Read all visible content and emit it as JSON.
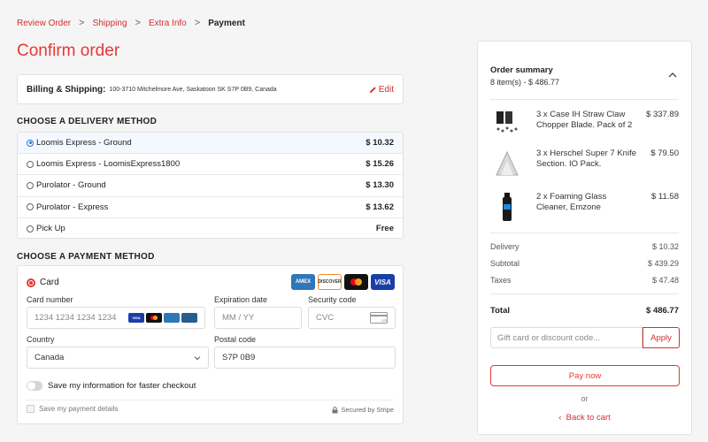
{
  "breadcrumb": {
    "items": [
      "Review Order",
      "Shipping",
      "Extra Info"
    ],
    "current": "Payment",
    "separator": ">"
  },
  "page_title": "Confirm order",
  "billing": {
    "label": "Billing & Shipping:",
    "address": "100-3710 Mitchelmore Ave, Saskatoon SK S7P 0B9, Canada",
    "edit_label": "Edit"
  },
  "delivery": {
    "heading": "CHOOSE A DELIVERY METHOD",
    "options": [
      {
        "label": "Loomis Express - Ground",
        "price": "$ 10.32",
        "selected": true
      },
      {
        "label": "Loomis Express - LoomisExpress1800",
        "price": "$ 15.26",
        "selected": false
      },
      {
        "label": "Purolator - Ground",
        "price": "$ 13.30",
        "selected": false
      },
      {
        "label": "Purolator - Express",
        "price": "$ 13.62",
        "selected": false
      },
      {
        "label": "Pick Up",
        "price": "Free",
        "selected": false
      }
    ]
  },
  "payment": {
    "heading": "CHOOSE A PAYMENT METHOD",
    "method_label": "Card",
    "brands": [
      "AMEX",
      "DISCOVER",
      "mastercard",
      "VISA"
    ],
    "card_number_label": "Card number",
    "card_number_placeholder": "1234 1234 1234 1234",
    "expiration_label": "Expiration date",
    "expiration_placeholder": "MM / YY",
    "security_label": "Security code",
    "security_placeholder": "CVC",
    "country_label": "Country",
    "country_value": "Canada",
    "postal_label": "Postal code",
    "postal_value": "S7P 0B9",
    "save_info_label": "Save my information for faster checkout",
    "save_details_label": "Save my payment details",
    "secured_label": "Secured by Stripe",
    "accent_color": "#e53935"
  },
  "summary": {
    "title": "Order summary",
    "subtitle": "8 item(s) -  $ 486.77",
    "items": [
      {
        "name": "3 x Case IH Straw Claw Chopper Blade. Pack of 2",
        "price": "$ 337.89"
      },
      {
        "name": "3 x Herschel Super 7 Knife Section. IO Pack.",
        "price": "$ 79.50"
      },
      {
        "name": "2 x Foaming Glass Cleaner, Emzone",
        "price": "$ 11.58"
      }
    ],
    "delivery_label": "Delivery",
    "delivery_value": "$ 10.32",
    "subtotal_label": "Subtotal",
    "subtotal_value": "$ 439.29",
    "taxes_label": "Taxes",
    "taxes_value": "$ 47.48",
    "total_label": "Total",
    "total_value": "$ 486.77",
    "gift_placeholder": "Gift card or discount code...",
    "apply_label": "Apply",
    "pay_label": "Pay now",
    "or_label": "or",
    "back_label": "Back to cart"
  }
}
